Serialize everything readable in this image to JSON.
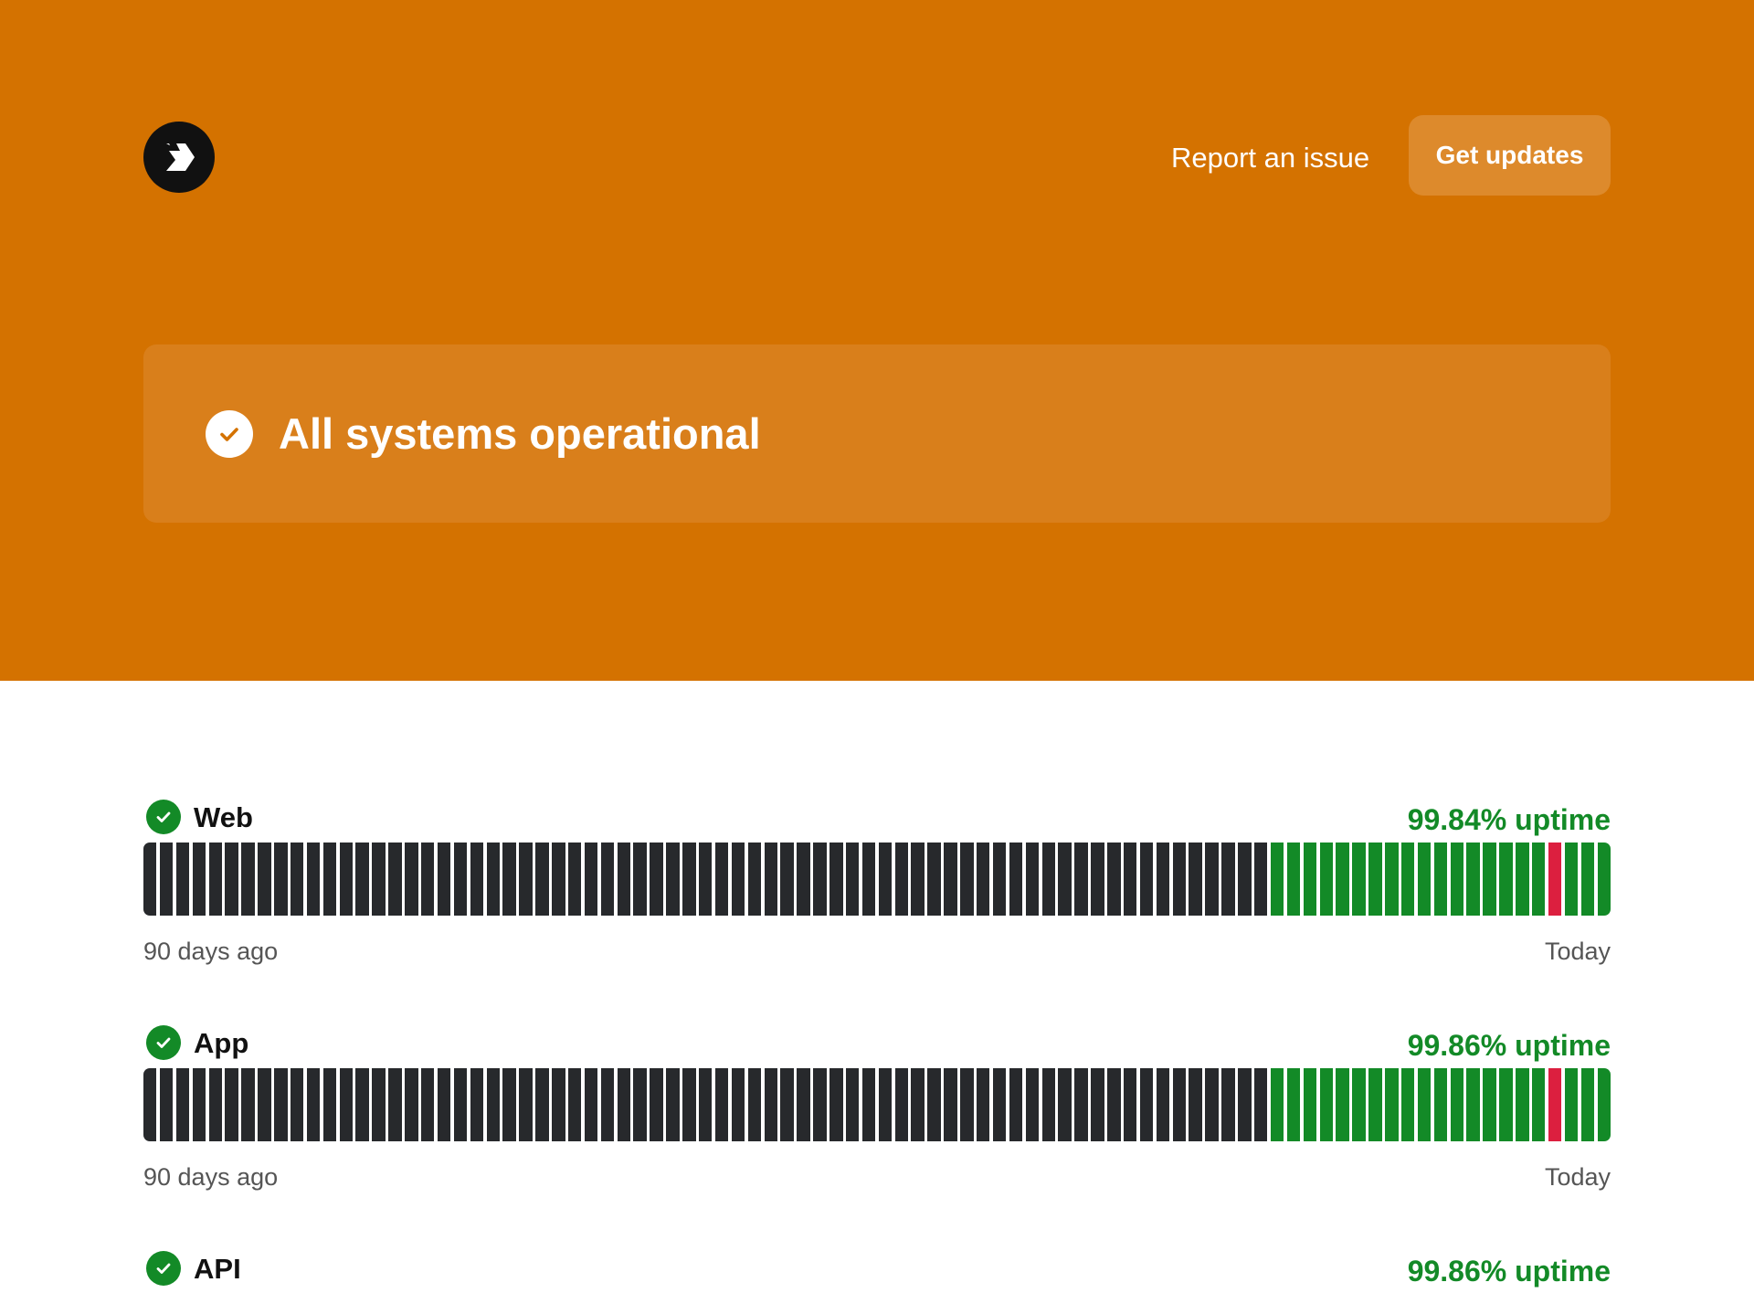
{
  "header": {
    "logo_icon": "chevron-logo-icon",
    "report_label": "Report an issue",
    "updates_label": "Get updates"
  },
  "status": {
    "icon": "check-circle-icon",
    "text": "All systems operational"
  },
  "colors": {
    "brand": "#d47200",
    "operational": "#138a27",
    "outage": "#dc1f3f",
    "no_data": "#27292c"
  },
  "components": [
    {
      "name": "Web",
      "uptime": "99.84% uptime",
      "range_start": "90 days ago",
      "range_end": "Today",
      "days": [
        "none",
        "none",
        "none",
        "none",
        "none",
        "none",
        "none",
        "none",
        "none",
        "none",
        "none",
        "none",
        "none",
        "none",
        "none",
        "none",
        "none",
        "none",
        "none",
        "none",
        "none",
        "none",
        "none",
        "none",
        "none",
        "none",
        "none",
        "none",
        "none",
        "none",
        "none",
        "none",
        "none",
        "none",
        "none",
        "none",
        "none",
        "none",
        "none",
        "none",
        "none",
        "none",
        "none",
        "none",
        "none",
        "none",
        "none",
        "none",
        "none",
        "none",
        "none",
        "none",
        "none",
        "none",
        "none",
        "none",
        "none",
        "none",
        "none",
        "none",
        "none",
        "none",
        "none",
        "none",
        "none",
        "none",
        "none",
        "none",
        "none",
        "up",
        "up",
        "up",
        "up",
        "up",
        "up",
        "up",
        "up",
        "up",
        "up",
        "up",
        "up",
        "up",
        "up",
        "up",
        "up",
        "up",
        "down",
        "up",
        "up",
        "up"
      ]
    },
    {
      "name": "App",
      "uptime": "99.86% uptime",
      "range_start": "90 days ago",
      "range_end": "Today",
      "days": [
        "none",
        "none",
        "none",
        "none",
        "none",
        "none",
        "none",
        "none",
        "none",
        "none",
        "none",
        "none",
        "none",
        "none",
        "none",
        "none",
        "none",
        "none",
        "none",
        "none",
        "none",
        "none",
        "none",
        "none",
        "none",
        "none",
        "none",
        "none",
        "none",
        "none",
        "none",
        "none",
        "none",
        "none",
        "none",
        "none",
        "none",
        "none",
        "none",
        "none",
        "none",
        "none",
        "none",
        "none",
        "none",
        "none",
        "none",
        "none",
        "none",
        "none",
        "none",
        "none",
        "none",
        "none",
        "none",
        "none",
        "none",
        "none",
        "none",
        "none",
        "none",
        "none",
        "none",
        "none",
        "none",
        "none",
        "none",
        "none",
        "none",
        "up",
        "up",
        "up",
        "up",
        "up",
        "up",
        "up",
        "up",
        "up",
        "up",
        "up",
        "up",
        "up",
        "up",
        "up",
        "up",
        "up",
        "down",
        "up",
        "up",
        "up"
      ]
    },
    {
      "name": "API",
      "uptime": "99.86% uptime"
    }
  ]
}
